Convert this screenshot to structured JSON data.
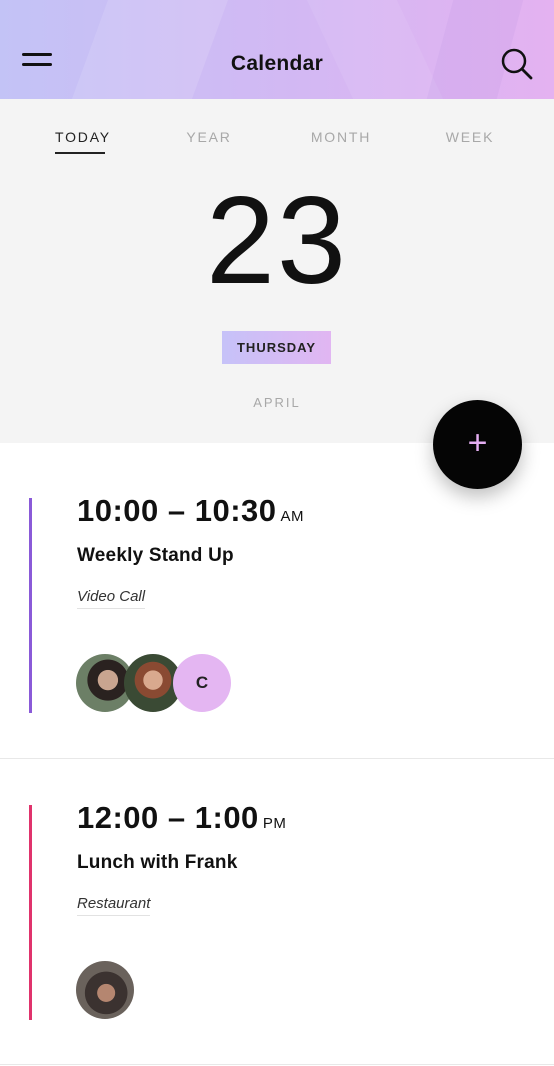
{
  "header": {
    "title": "Calendar",
    "menu_icon": "hamburger-menu-icon",
    "search_icon": "search-icon",
    "gradient": [
      "#c3c3f6",
      "#e4b2f1"
    ]
  },
  "tabs": [
    {
      "label": "TODAY",
      "active": true
    },
    {
      "label": "YEAR",
      "active": false
    },
    {
      "label": "MONTH",
      "active": false
    },
    {
      "label": "WEEK",
      "active": false
    }
  ],
  "date": {
    "day": "23",
    "weekday": "THURSDAY",
    "month": "APRIL"
  },
  "fab": {
    "icon": "plus-icon",
    "label": "+"
  },
  "events": [
    {
      "time": "10:00 – 10:30",
      "period": "AM",
      "title": "Weekly Stand Up",
      "location": "Video Call",
      "accent": "#8a5ad8",
      "attendees": [
        {
          "type": "photo"
        },
        {
          "type": "photo"
        },
        {
          "type": "initial",
          "initial": "C"
        }
      ]
    },
    {
      "time": "12:00 – 1:00",
      "period": "PM",
      "title": "Lunch with Frank",
      "location": "Restaurant",
      "accent": "#e0336c",
      "attendees": [
        {
          "type": "photo"
        }
      ]
    }
  ]
}
